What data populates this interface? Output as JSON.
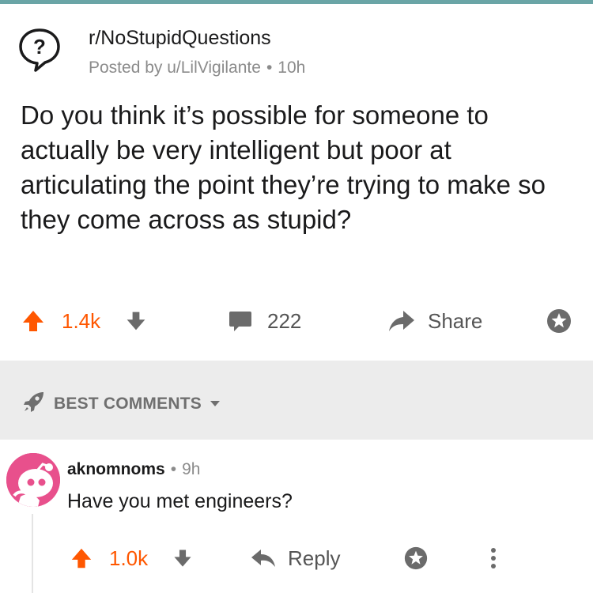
{
  "post": {
    "subreddit": "r/NoStupidQuestions",
    "posted_by": "Posted by u/LilVigilante",
    "separator": "•",
    "age": "10h",
    "title": "Do you think it’s possible for someone to actually be very intelligent but poor at articulating the point they’re trying to make so they come across as stupid?",
    "score": "1.4k",
    "comments": "222",
    "share_label": "Share"
  },
  "sort": {
    "label": "BEST COMMENTS"
  },
  "comment": {
    "author": "aknomnoms",
    "separator": "•",
    "age": "9h",
    "body": "Have you met engineers?",
    "score": "1.0k",
    "reply_label": "Reply"
  },
  "colors": {
    "upvote": "#ff5700",
    "muted": "#8b8b8b",
    "band": "#ececec",
    "avatar": "#e8508c",
    "accent_line": "#6aa5a6"
  },
  "icons": {
    "subreddit": "question-bubble-icon",
    "upvote": "upvote-arrow-icon",
    "downvote": "downvote-arrow-icon",
    "comments": "comment-bubble-icon",
    "share": "share-arrow-icon",
    "award": "award-icon",
    "sort": "rocket-icon",
    "caret": "caret-down-icon",
    "reply": "reply-arrow-icon",
    "more": "more-vertical-icon"
  }
}
